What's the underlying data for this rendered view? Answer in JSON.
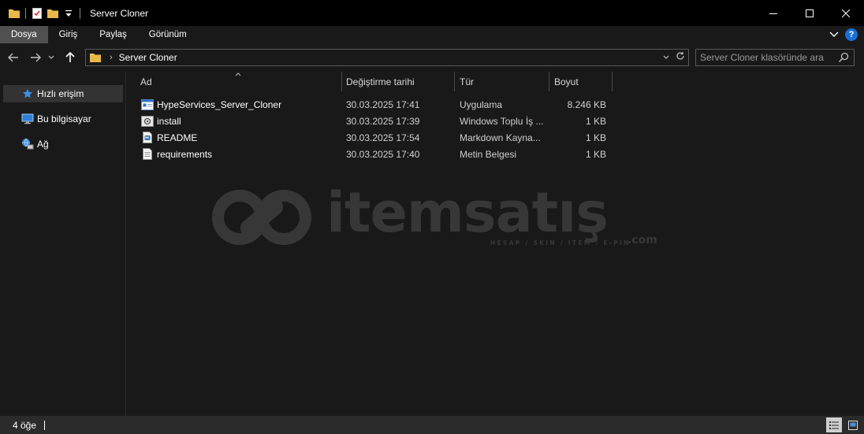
{
  "window": {
    "title": "Server Cloner",
    "controls": {
      "minimize": "—",
      "maximize": "☐",
      "close": "✕"
    }
  },
  "ribbon": {
    "tabs": [
      {
        "label": "Dosya",
        "active": true
      },
      {
        "label": "Giriş",
        "active": false
      },
      {
        "label": "Paylaş",
        "active": false
      },
      {
        "label": "Görünüm",
        "active": false
      }
    ],
    "help": "?"
  },
  "address": {
    "breadcrumb": "Server Cloner"
  },
  "search": {
    "placeholder": "Server Cloner klasöründe ara"
  },
  "sidebar": {
    "items": [
      {
        "label": "Hızlı erişim",
        "icon": "star-icon",
        "active": true
      },
      {
        "label": "Bu bilgisayar",
        "icon": "computer-icon",
        "active": false
      },
      {
        "label": "Ağ",
        "icon": "network-icon",
        "active": false
      }
    ]
  },
  "columns": {
    "name": "Ad",
    "date": "Değiştirme tarihi",
    "type": "Tür",
    "size": "Boyut"
  },
  "files": [
    {
      "name": "HypeServices_Server_Cloner",
      "date": "30.03.2025 17:41",
      "type": "Uygulama",
      "size": "8.246 KB",
      "icon": "application-icon"
    },
    {
      "name": "install",
      "date": "30.03.2025 17:39",
      "type": "Windows Toplu İş ...",
      "size": "1 KB",
      "icon": "batch-file-icon"
    },
    {
      "name": "README",
      "date": "30.03.2025 17:54",
      "type": "Markdown Kayna...",
      "size": "1 KB",
      "icon": "markdown-file-icon"
    },
    {
      "name": "requirements",
      "date": "30.03.2025 17:40",
      "type": "Metin Belgesi",
      "size": "1 KB",
      "icon": "text-file-icon"
    }
  ],
  "watermark": {
    "brand": "itemsatış",
    "tagline": "HESAP / SKIN / ITEM / E-PIN",
    "suffix": ".com"
  },
  "status": {
    "item_count": "4 öğe"
  },
  "colors": {
    "background": "#191919",
    "titlebar": "#000000",
    "active_tab": "#505050",
    "selection": "#333333",
    "statusbar": "#2b2b2b",
    "folder": "#f2c55c",
    "accent_blue": "#1a6fd6"
  }
}
